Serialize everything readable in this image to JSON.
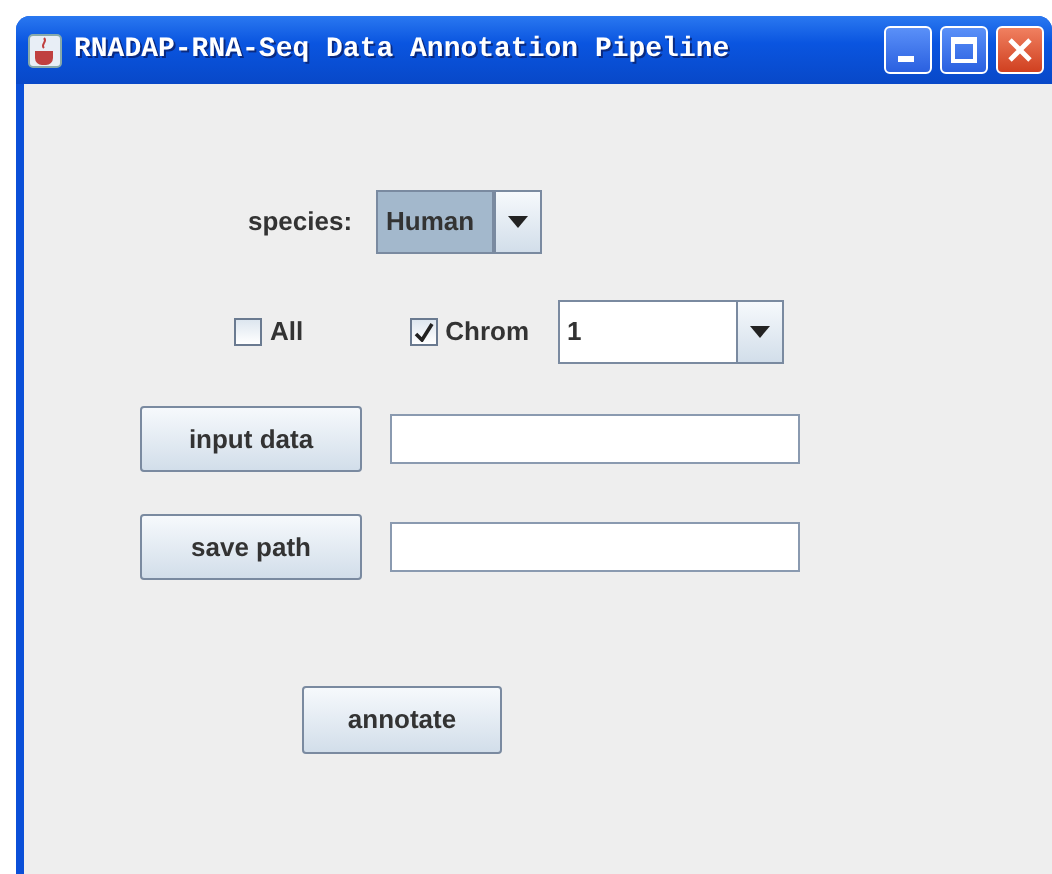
{
  "window": {
    "title": "RNADAP-RNA-Seq Data Annotation Pipeline"
  },
  "species": {
    "label": "species:",
    "value": "Human",
    "focused": true
  },
  "all": {
    "label": "All",
    "checked": false
  },
  "chrom": {
    "label": "Chrom",
    "checked": true,
    "value": "1"
  },
  "input_button": "input data",
  "save_button": "save path",
  "annotate_button": "annotate"
}
